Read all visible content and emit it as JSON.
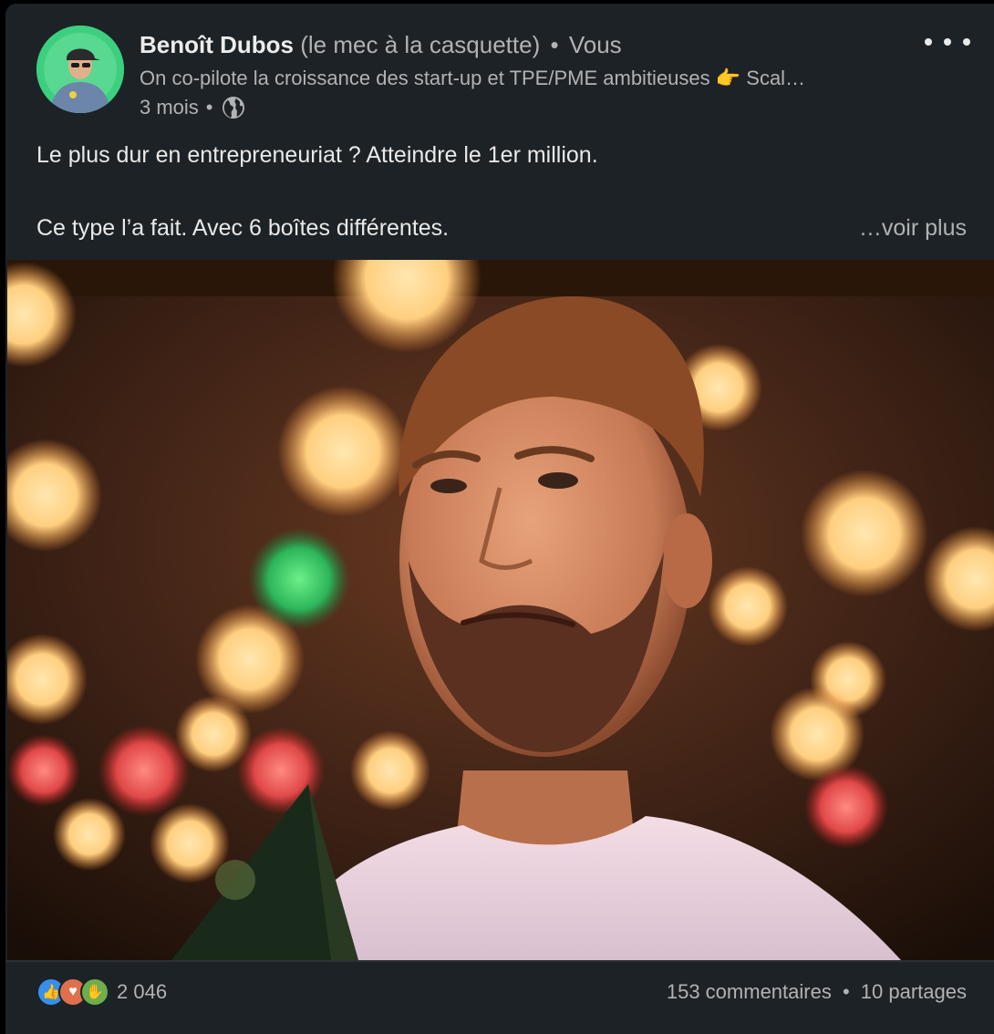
{
  "post": {
    "author_name": "Benoît Dubos",
    "author_nickname": "(le mec à la casquette)",
    "separator": "•",
    "relation": "Vous",
    "headline": "On co-pilote la croissance des start-up et TPE/PME ambitieuses 👉 Scal…",
    "time": "3 mois",
    "time_separator": "•",
    "text_line1": "Le plus dur en entrepreneuriat ? Atteindre le 1er million.",
    "text_line2": "Ce type l’a fait. Avec 6 boîtes différentes.",
    "see_more": "…voir plus"
  },
  "reactions": {
    "count": "2 046",
    "icons": [
      "like-icon",
      "love-icon",
      "support-icon"
    ]
  },
  "stats": {
    "comments": "153 commentaires",
    "separator": "•",
    "shares": "10 partages"
  },
  "colors": {
    "card_bg": "#1d2226",
    "text_primary": "#e9e9e9",
    "text_secondary": "#b0b3b6",
    "avatar_ring": "#35c87a"
  }
}
